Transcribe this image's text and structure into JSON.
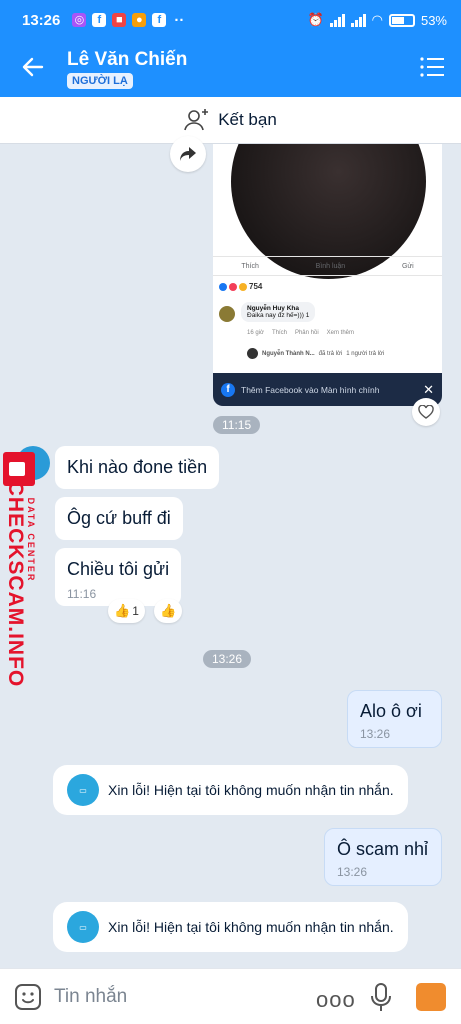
{
  "status_bar": {
    "time": "13:26",
    "battery": "53%",
    "app_icons": [
      "messenger-icon",
      "facebook-icon",
      "news-icon",
      "camera-icon",
      "facebook-icon"
    ],
    "more": "··"
  },
  "header": {
    "contact_name": "Lê Văn Chiến",
    "stranger_tag": "NGƯỜI LẠ"
  },
  "friend_bar": {
    "label": "Kết bạn"
  },
  "shared_post": {
    "actions": [
      "Thích",
      "Bình luận",
      "Gửi"
    ],
    "reaction_count": "754",
    "comment_author": "Nguyễn Huy Kha",
    "comment_text": "Đaika nay đz hế=)))",
    "comment_reacts": "1",
    "comment_time": "16 giờ",
    "comment_like": "Thích",
    "comment_reply": "Phản hồi",
    "comment_more": "Xem thêm",
    "reply_author": "Nguyễn Thành N...",
    "reply_action": "đã trả lời",
    "reply_count": "1 người trả lời",
    "banner_text": "Thêm Facebook vào Màn hình chính",
    "time": "11:15"
  },
  "messages": [
    {
      "text": "Khi nào đone tiền"
    },
    {
      "text": "Ôg cứ buff đi"
    },
    {
      "text": "Chiều tôi gửi",
      "time": "11:16",
      "reaction_count": "1"
    }
  ],
  "divider_time": "13:26",
  "outgoing": [
    {
      "text": "Alo ô ơi",
      "time": "13:26"
    },
    {
      "text": "Ô scam nhỉ",
      "time": "13:26"
    }
  ],
  "system_message": "Xin lỗi! Hiện tại tôi không muốn nhận tin nhắn.",
  "input": {
    "placeholder": "Tin nhắn",
    "more": "ooo"
  },
  "watermark": {
    "brand": "CHECKSCAM.INFO",
    "sub": "DATA CENTER"
  },
  "colors": {
    "accent": "#1e90ff",
    "watermark": "#e4132c",
    "background": "#e2e9f1"
  }
}
